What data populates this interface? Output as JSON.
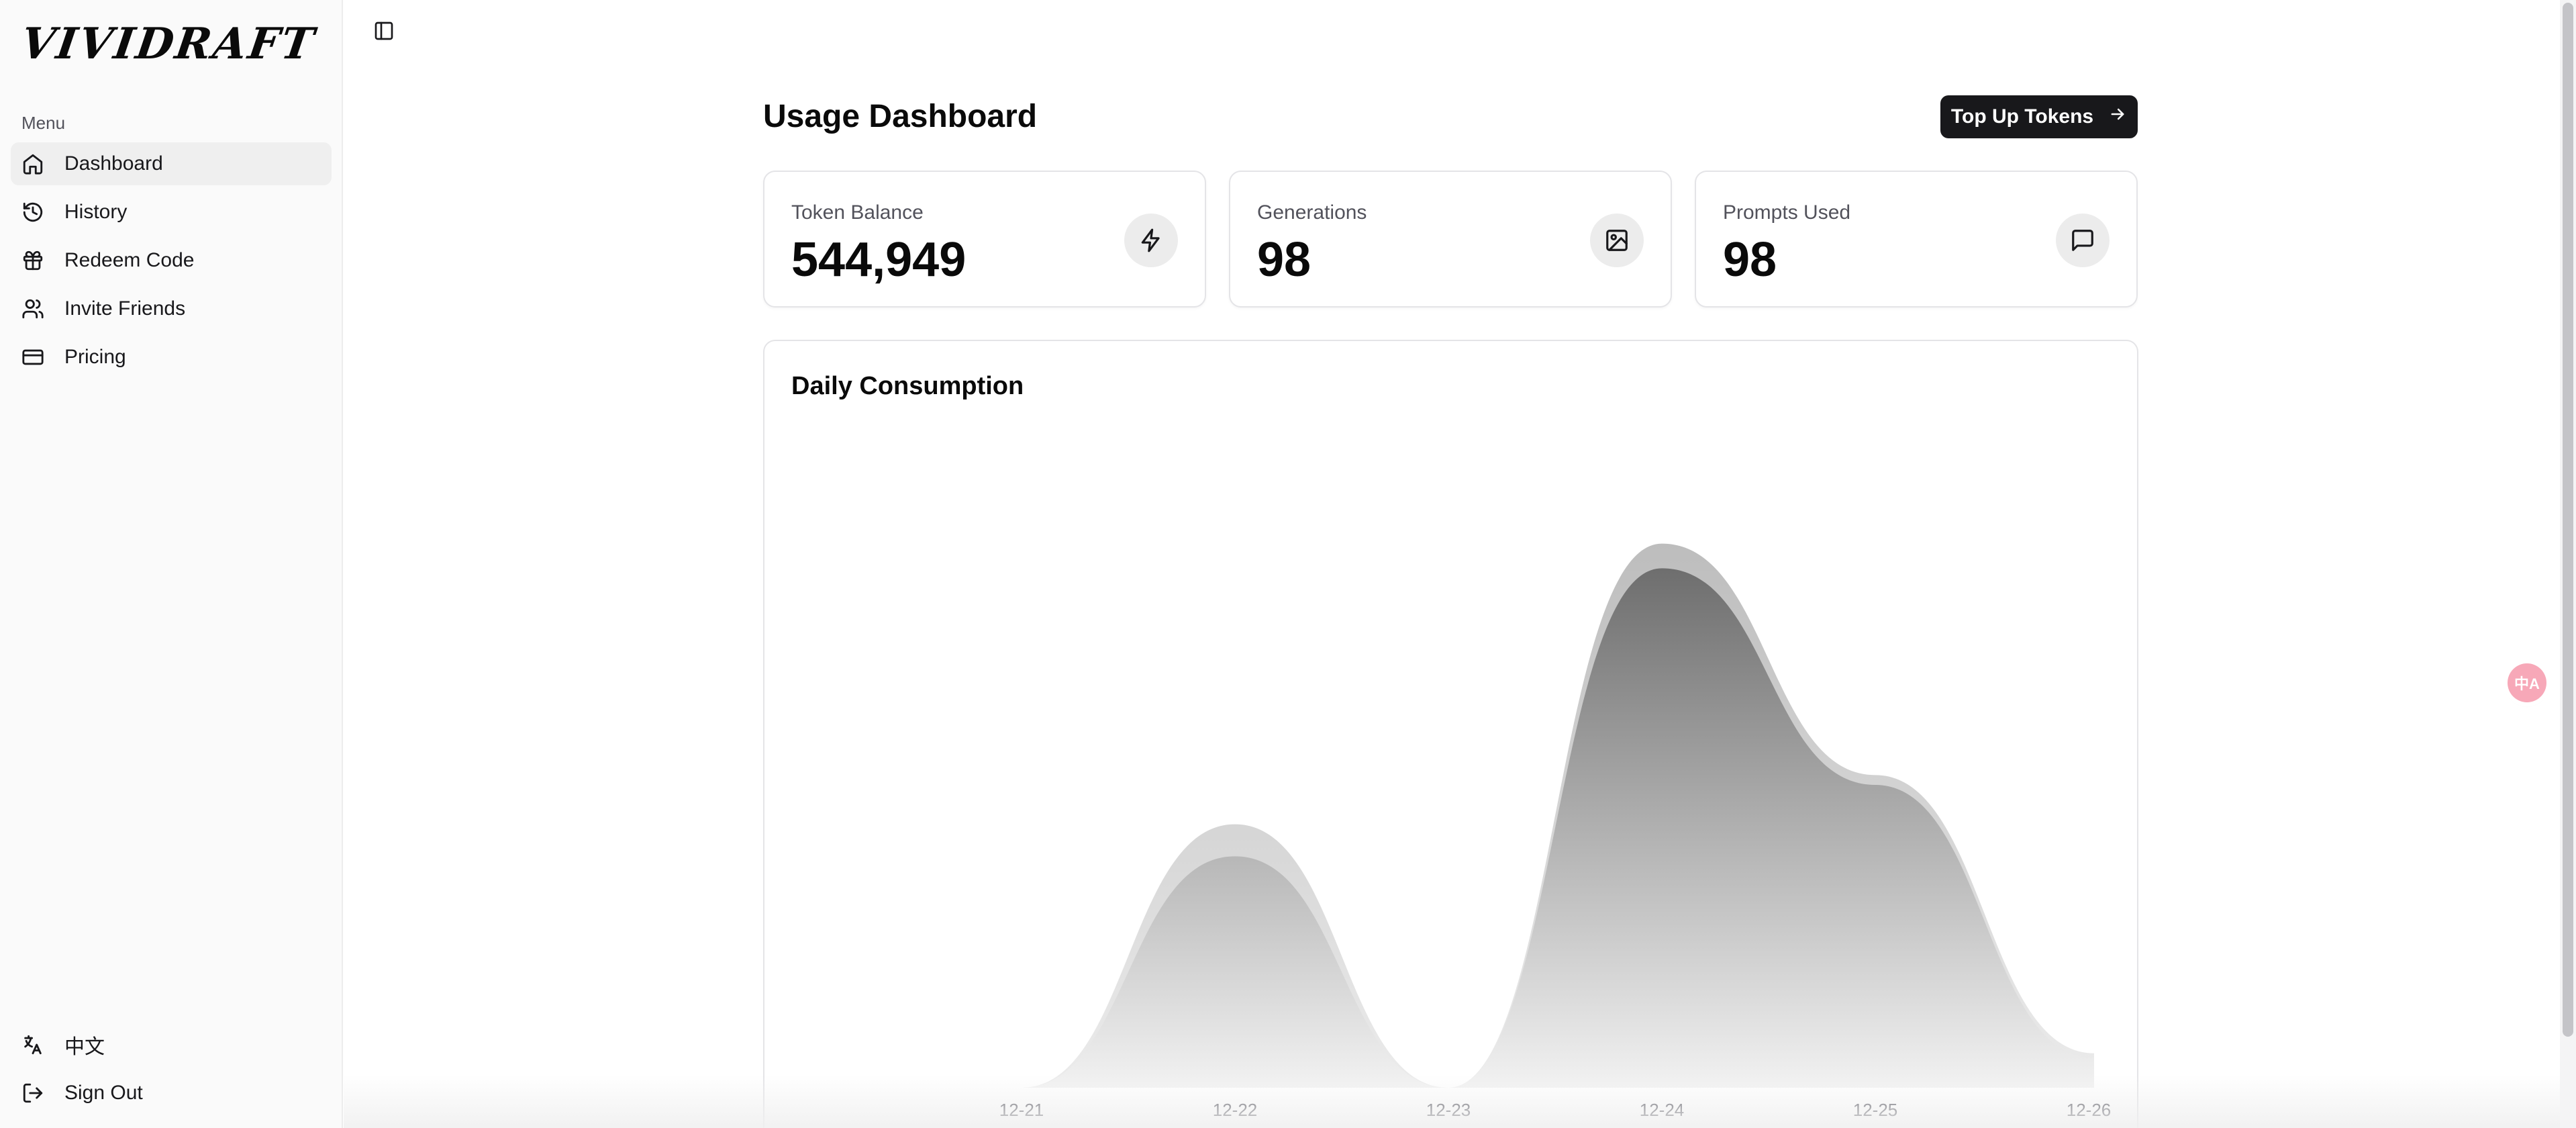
{
  "app": {
    "brand": "VIVIDRAFT"
  },
  "sidebar": {
    "menu_label": "Menu",
    "items": [
      {
        "label": "Dashboard",
        "icon": "home-icon"
      },
      {
        "label": "History",
        "icon": "history-icon"
      },
      {
        "label": "Redeem Code",
        "icon": "gift-icon"
      },
      {
        "label": "Invite Friends",
        "icon": "users-icon"
      },
      {
        "label": "Pricing",
        "icon": "credit-card-icon"
      }
    ],
    "bottom": [
      {
        "label": "中文",
        "icon": "language-icon"
      },
      {
        "label": "Sign Out",
        "icon": "sign-out-icon"
      }
    ]
  },
  "header": {
    "title": "Usage Dashboard",
    "topup_label": "Top Up Tokens"
  },
  "stats": [
    {
      "label": "Token Balance",
      "value": "544,949",
      "icon": "zap-icon"
    },
    {
      "label": "Generations",
      "value": "98",
      "icon": "image-icon"
    },
    {
      "label": "Prompts Used",
      "value": "98",
      "icon": "message-square-icon"
    }
  ],
  "floating": {
    "translate_glyph": "中A"
  },
  "chart_data": {
    "type": "area",
    "title": "Daily Consumption",
    "categories": [
      "12-21",
      "12-22",
      "12-23",
      "12-24",
      "12-25",
      "12-26"
    ],
    "series": [
      {
        "values": [
          0,
          1070,
          0,
          2210,
          1270,
          140
        ],
        "color": "#c8c8c8"
      },
      {
        "values": [
          0,
          940,
          0,
          2110,
          1230,
          120
        ],
        "color": "#7a7a7a"
      }
    ],
    "ylim": [
      0,
      2400
    ],
    "grid": false,
    "legend": "none"
  }
}
